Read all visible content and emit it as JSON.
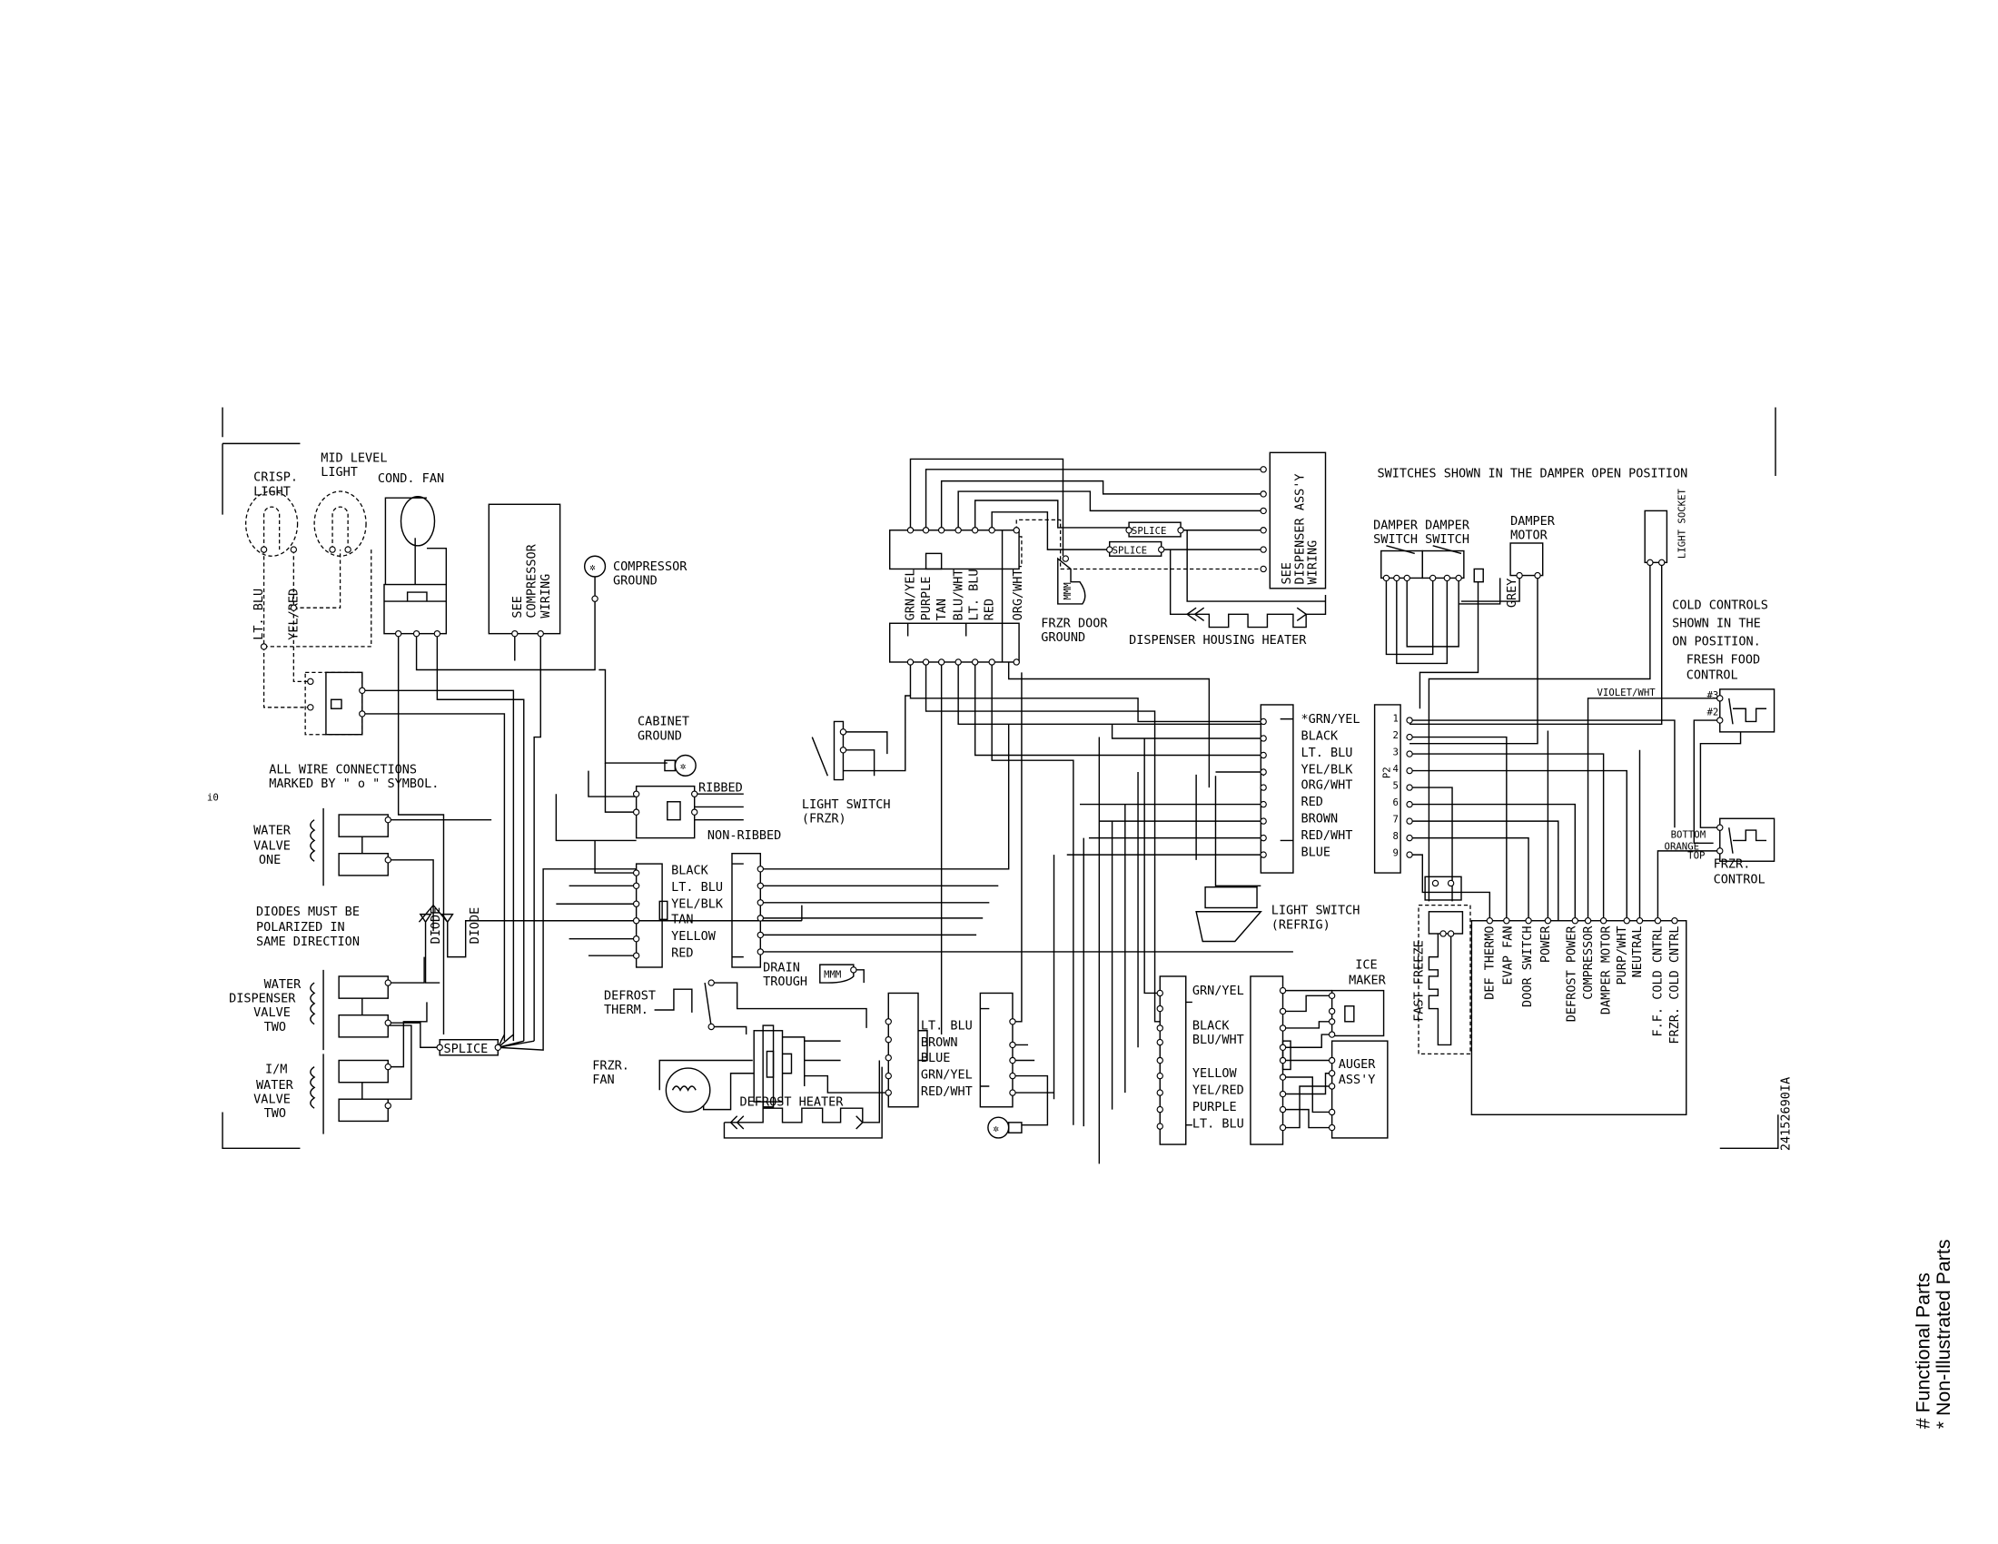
{
  "diagram": {
    "doc_number": "24152690IA",
    "edge_mark": "i0",
    "notes": {
      "connections": [
        "ALL WIRE CONNECTIONS",
        "MARKED BY \" o \" SYMBOL."
      ],
      "diodes": [
        "DIODES MUST BE",
        "POLARIZED IN",
        "SAME DIRECTION"
      ],
      "damper": "SWITCHES SHOWN IN THE DAMPER OPEN POSITION",
      "cold_controls": [
        "COLD CONTROLS",
        "SHOWN IN THE",
        "ON POSITION."
      ]
    },
    "components": {
      "crisp_light": [
        "CRISP.",
        "LIGHT"
      ],
      "mid_level_light": [
        "MID LEVEL",
        "LIGHT"
      ],
      "cond_fan": "COND. FAN",
      "compressor_wiring": [
        "SEE",
        "COMPRESSOR",
        "WIRING"
      ],
      "compressor_ground": [
        "COMPRESSOR",
        "GROUND"
      ],
      "cabinet_ground": [
        "CABINET",
        "GROUND"
      ],
      "ribbed": "RIBBED",
      "non_ribbed": "NON-RIBBED",
      "light_switch_frzr": [
        "LIGHT SWITCH",
        "(FRZR)"
      ],
      "water_valve_one": [
        "WATER",
        "VALVE",
        "ONE"
      ],
      "water_dispenser_valve_two": [
        "WATER",
        "DISPENSER",
        "VALVE",
        "TWO"
      ],
      "im_water_valve_two": [
        "I/M",
        "WATER",
        "VALVE",
        "TWO"
      ],
      "diode": "DIODE",
      "splice": "SPLICE",
      "drain_trough": [
        "DRAIN",
        "TROUGH"
      ],
      "defrost_therm": [
        "DEFROST",
        "THERM."
      ],
      "frzr_fan": [
        "FRZR.",
        "FAN"
      ],
      "defrost_heater": "DEFROST HEATER",
      "frzr_door_ground": [
        "FRZR DOOR",
        "GROUND"
      ],
      "dispenser_housing_heater": "DISPENSER HOUSING HEATER",
      "dispenser_wiring": [
        "SEE",
        "DISPENSER ASS'Y",
        "WIRING"
      ],
      "light_switch_refrig": [
        "LIGHT SWITCH",
        "(REFRIG)"
      ],
      "ice_maker": [
        "ICE",
        "MAKER"
      ],
      "auger": [
        "AUGER",
        "ASS'Y"
      ],
      "damper_switches": [
        "DAMPER DAMPER",
        "SWITCH SWITCH"
      ],
      "damper_motor": [
        "DAMPER",
        "MOTOR"
      ],
      "light_socket": "LIGHT SOCKET",
      "fresh_food_control": [
        "FRESH FOOD",
        "CONTROL"
      ],
      "frzr_control": [
        "FRZR.",
        "CONTROL"
      ],
      "fast_freeze": "FAST FREEZE",
      "p2": "P2"
    },
    "wire_labels": {
      "left_vertical": [
        "LT. BLU",
        "YEL/RED"
      ],
      "grey": "GREY",
      "violet_wht": "VIOLET/WHT",
      "ff_pins": [
        "#3",
        "#2"
      ],
      "frzr_pins": [
        "BOTTOM",
        "ORANGE",
        "TOP"
      ]
    },
    "connectors": {
      "left_block": [
        "BLACK",
        "LT. BLU",
        "YEL/BLK",
        "TAN",
        "YELLOW",
        "RED"
      ],
      "top_block": [
        "GRN/YEL",
        "PURPLE",
        "TAN",
        "BLU/WHT",
        "LT. BLU",
        "RED",
        "ORG/WHT"
      ],
      "right_block": [
        "*GRN/YEL",
        "BLACK",
        "LT. BLU",
        "YEL/BLK",
        "ORG/WHT",
        "RED",
        "BROWN",
        "RED/WHT",
        "BLUE"
      ],
      "defrost_block": [
        "LT. BLU",
        "BROWN",
        "BLUE",
        "GRN/YEL",
        "RED/WHT"
      ],
      "ice_block": [
        "GRN/YEL",
        "BLACK",
        "BLU/WHT",
        "YELLOW",
        "YEL/RED",
        "PURPLE",
        "LT. BLU"
      ],
      "p2_pins": [
        "1",
        "2",
        "3",
        "4",
        "5",
        "6",
        "7",
        "8",
        "9"
      ],
      "board": [
        "DEF THERMO",
        "EVAP FAN",
        "DOOR SWITCH",
        "POWER",
        "DEFROST POWER",
        "COMPRESSOR",
        "DAMPER MOTOR",
        "PURP/WHT",
        "NEUTRAL",
        "F.F. COLD CNTRL",
        "FRZR. COLD CNTRL"
      ]
    }
  },
  "legend": {
    "functional": "# Functional Parts",
    "non_illustrated": "* Non-Illustrated Parts"
  }
}
